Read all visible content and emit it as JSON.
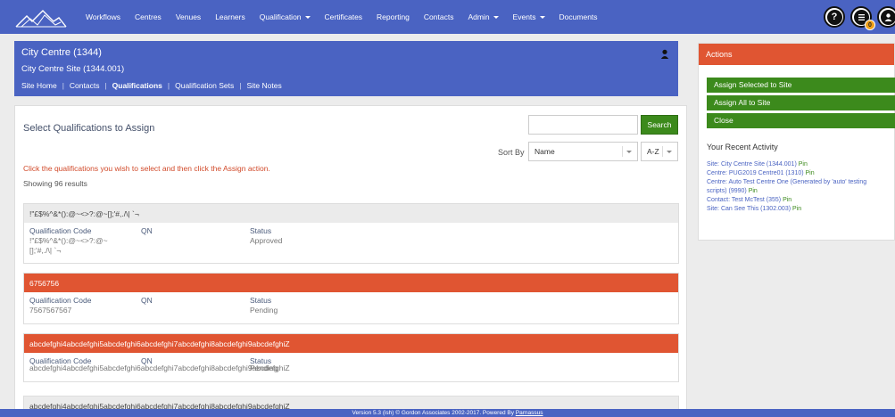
{
  "nav": {
    "items": [
      {
        "label": "Workflows",
        "dropdown": false
      },
      {
        "label": "Centres",
        "dropdown": false
      },
      {
        "label": "Venues",
        "dropdown": false
      },
      {
        "label": "Learners",
        "dropdown": false
      },
      {
        "label": "Qualification",
        "dropdown": true
      },
      {
        "label": "Certificates",
        "dropdown": false
      },
      {
        "label": "Reporting",
        "dropdown": false
      },
      {
        "label": "Contacts",
        "dropdown": false
      },
      {
        "label": "Admin",
        "dropdown": true
      },
      {
        "label": "Events",
        "dropdown": true
      },
      {
        "label": "Documents",
        "dropdown": false
      }
    ],
    "help_glyph": "?",
    "badge_count": "0"
  },
  "header": {
    "title": "City Centre (1344)",
    "subtitle": "City Centre Site (1344.001)",
    "links": [
      "Site Home",
      "Contacts",
      "Qualifications",
      "Qualification Sets",
      "Site Notes"
    ],
    "active_link": "Qualifications"
  },
  "main": {
    "title": "Select Qualifications to Assign",
    "search": {
      "placeholder": "",
      "button": "Search"
    },
    "sort": {
      "label": "Sort By",
      "field": "Name",
      "order": "A-Z"
    },
    "instruction": "Click the qualifications you wish to select and then click the Assign action.",
    "showing": "Showing 96 results",
    "columns": {
      "code": "Qualification Code",
      "qn": "QN",
      "status": "Status"
    },
    "qualifications": [
      {
        "name": "!\"£$%^&*():@~<>?:@~[];'#,./\\| `¬",
        "code": "!\"£$%^&*():@~<>?:@~\n[];'#,./\\| `¬",
        "qn": "",
        "status": "Approved",
        "selected": false
      },
      {
        "name": "6756756",
        "code": "7567567567",
        "qn": "",
        "status": "Pending",
        "selected": true
      },
      {
        "name": "abcdefghi4abcdefghi5abcdefghi6abcdefghi7abcdefghi8abcdefghi9abcdefghiZ",
        "code": "abcdefghi4abcdefghi5abcdefghi6abcdefghi7abcdefghi8abcdefghi9abcdefghiZ",
        "qn": "",
        "status": "Pending",
        "selected": true
      },
      {
        "name": "abcdefghi4abcdefghi5abcdefghi6abcdefghi7abcdefghi8abcdefghi9abcdefghiZ",
        "code": "",
        "qn": "",
        "status": "",
        "selected": false
      }
    ]
  },
  "actions": {
    "title": "Actions",
    "buttons": [
      "Assign Selected to Site",
      "Assign All to Site",
      "Close"
    ],
    "recent_title": "Your Recent Activity",
    "recent": [
      {
        "text": "Site: City Centre Site (1344.001)",
        "pin": "Pin"
      },
      {
        "text": "Centre: PUG2019 Centre01 (1310)",
        "pin": "Pin"
      },
      {
        "text": "Centre: Auto Test Centre One (Generated by 'auto' testing",
        "pin": ""
      },
      {
        "text": "scripts) (9990)",
        "pin": "Pin"
      },
      {
        "text": "Contact: Test McTest (355)",
        "pin": "Pin"
      },
      {
        "text": "Site: Can See This (1302.003)",
        "pin": "Pin"
      }
    ]
  },
  "footer": {
    "text": "Version 5.3 (ish) © Gordon Associates 2002-2017. Powered By ",
    "link": "Parnassus"
  },
  "colors": {
    "brand_blue": "#4a63c2",
    "accent_orange": "#e05532",
    "action_green": "#3c8a1c"
  }
}
